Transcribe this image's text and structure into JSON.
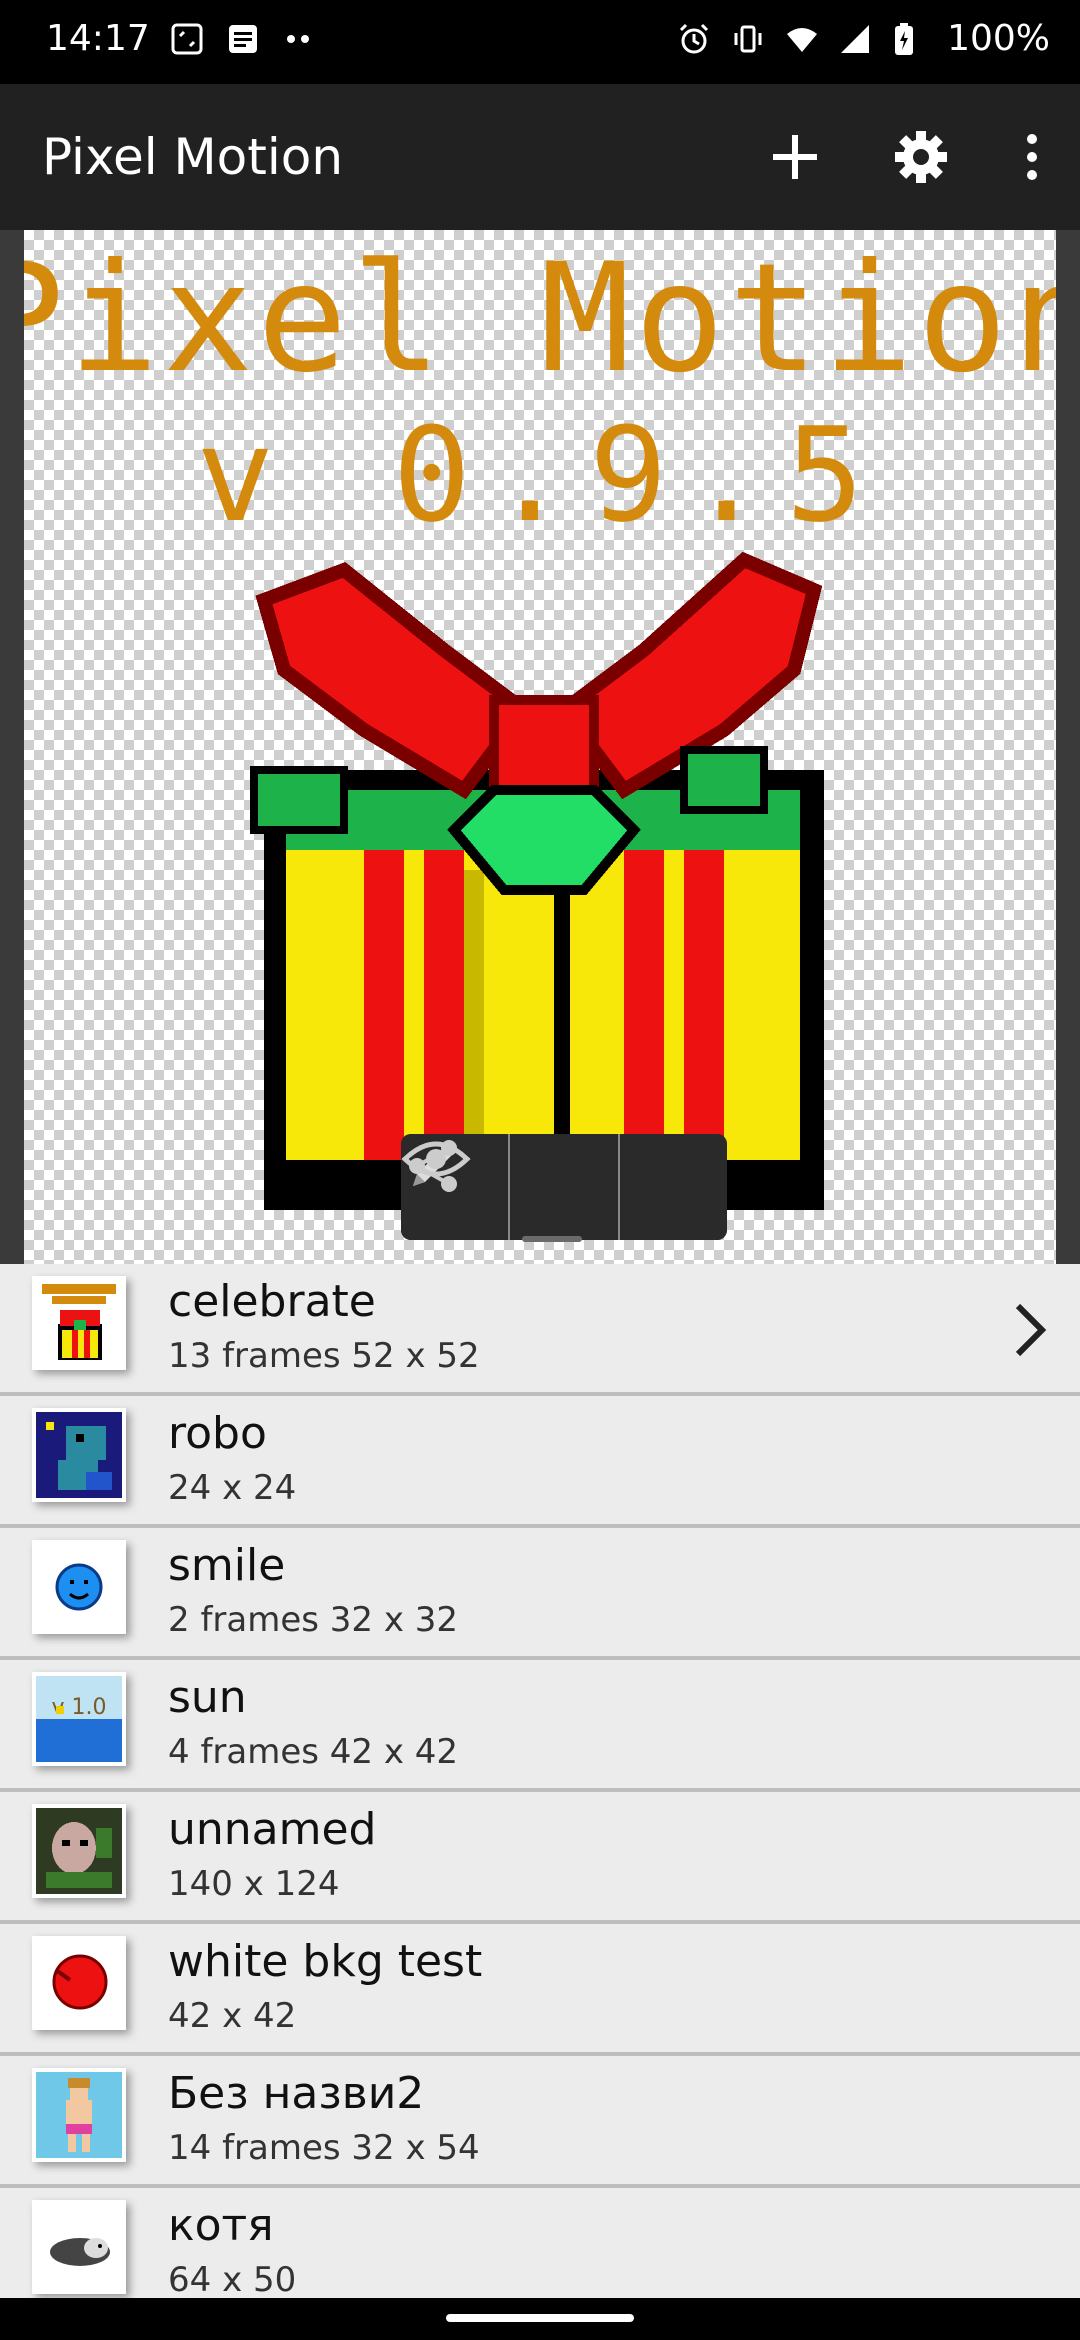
{
  "status_bar": {
    "time": "14:17",
    "battery": "100%",
    "left_icons": [
      "screenshot-icon",
      "note-icon",
      "more-dots-icon"
    ],
    "right_icons": [
      "alarm-icon",
      "vibrate-icon",
      "wifi-icon",
      "signal-icon",
      "battery-icon"
    ]
  },
  "app_bar": {
    "title": "Pixel Motion",
    "actions": [
      "add-icon",
      "settings-icon",
      "overflow-menu-icon"
    ]
  },
  "preview": {
    "line1": "Pixel Motion",
    "line2": "v 0.9.5",
    "tools": [
      "pencil-icon",
      "eye-icon",
      "share-icon"
    ]
  },
  "projects": [
    {
      "name": "celebrate",
      "meta": "13 frames 52 x 52",
      "selected": true
    },
    {
      "name": "robo",
      "meta": "24 x 24"
    },
    {
      "name": "smile",
      "meta": "2 frames 32 x 32"
    },
    {
      "name": "sun",
      "meta": "4 frames 42 x 42"
    },
    {
      "name": "unnamed",
      "meta": "140 x 124"
    },
    {
      "name": "white bkg test",
      "meta": "42 x 42"
    },
    {
      "name": "Без назви2",
      "meta": "14 frames 32 x 54"
    },
    {
      "name": "котя",
      "meta": "64 x 50"
    }
  ],
  "colors": {
    "app_bar": "#212121",
    "title_text": "#d48a0c",
    "list_bg": "#ececec"
  }
}
